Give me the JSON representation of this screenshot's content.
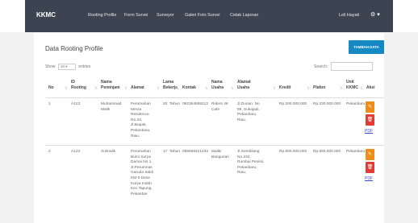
{
  "navbar": {
    "brand": "KKMC",
    "links": [
      "Rooting Profile",
      "Form Survei",
      "Surveyor",
      "Galeri Foto Survei",
      "Cetak Laporan"
    ],
    "user_name": "Leli Hayati",
    "gear": "⚙ ▾"
  },
  "panel": {
    "title": "Data Rooting Profile",
    "add_button": "TAMBAH DATA",
    "show_label": "Show",
    "entries_value": "10",
    "entries_label": "entries",
    "search_label": "Search:"
  },
  "table": {
    "headers": [
      "No",
      "ID\nRooting",
      "Nama\nPeminjam",
      "Alamat",
      "Lama\nBekerja",
      "Kontak",
      "Nama\nUsaha",
      "Alamat\nUsaha",
      "Kredit",
      "Plafon",
      "Unit\nKKMC",
      "Aksi"
    ],
    "rows": [
      {
        "no": "1",
        "id": "A123",
        "nama": "Muhammad\nMalik",
        "alamat": "Perumahan\nMerza\nResidence\nNo.23,\nJl.Bupati,\nPekanbaru,\nRiau.",
        "lama": "20  Tahun",
        "kontak": "082364558212",
        "usaha": "Riders 46\nCafe",
        "alamat_usaha": "Jl.Durian, No\n89, Sukajadi,\nPekanbaru,\nRiau.",
        "kredit": "Rp.200.000.000",
        "plafon": "Rp.230.000.000",
        "unit": "Pekanbaru",
        "pdf": "PDF"
      },
      {
        "no": "2",
        "id": "A124",
        "nama": "Sulmalik",
        "alamat": "Perumahan\nBumi Surya\nDamai No 1,\nJl.Perumnas\nGaruda Sakti\nKM 6 Desa\nKarya Indah\nKec.Tapung,\nPekanbar",
        "lama": "17  Tahun",
        "kontak": "085668421232",
        "usaha": "Maliki\nBangunan",
        "alamat_usaha": "Jl.Sembilang\nNo.234,\nRumbai Pesisir,\nPekanbaru,\nRiau.",
        "kredit": "Rp.600.000.000",
        "plafon": "Rp.650.000.000",
        "unit": "Pekanbaru",
        "pdf": "PDF"
      }
    ]
  },
  "icons": {
    "edit": "✎",
    "delete": "🗑",
    "sort": "⇅"
  },
  "colors": {
    "navbar": "#3d4451",
    "primary": "#1589c4",
    "edit": "#f08c1a",
    "delete": "#e23b35"
  }
}
